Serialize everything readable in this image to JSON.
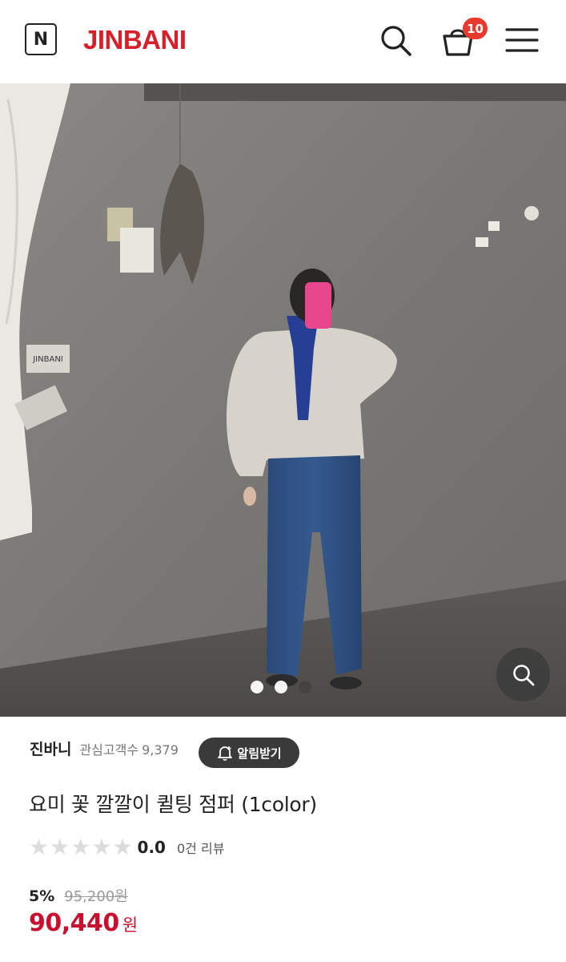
{
  "header": {
    "logo_letter": "N",
    "brand": "JINBANI",
    "cart_count": "10",
    "icons": [
      "search-icon",
      "cart-icon",
      "menu-icon"
    ]
  },
  "gallery": {
    "sign_text": "JINBANI",
    "slides_total": 3,
    "active_slide": 2,
    "zoom_icon": "zoom-icon"
  },
  "product": {
    "seller": "진바니",
    "followers_label": "관심고객수",
    "followers_count": "9,379",
    "notify_label": "알림받기",
    "title": "요미 꽃 깔깔이 퀼팅 점퍼 (1color)",
    "rating": "0.0",
    "stars_total": 5,
    "stars_filled": 0,
    "review_count": "0건 리뷰",
    "discount": "5%",
    "original_price": "95,200원",
    "sale_price": "90,440",
    "currency": "원"
  },
  "colors": {
    "brand": "#d7202a",
    "price": "#c8102e",
    "badge": "#e8392f",
    "button_dark": "#3a3a3a"
  }
}
